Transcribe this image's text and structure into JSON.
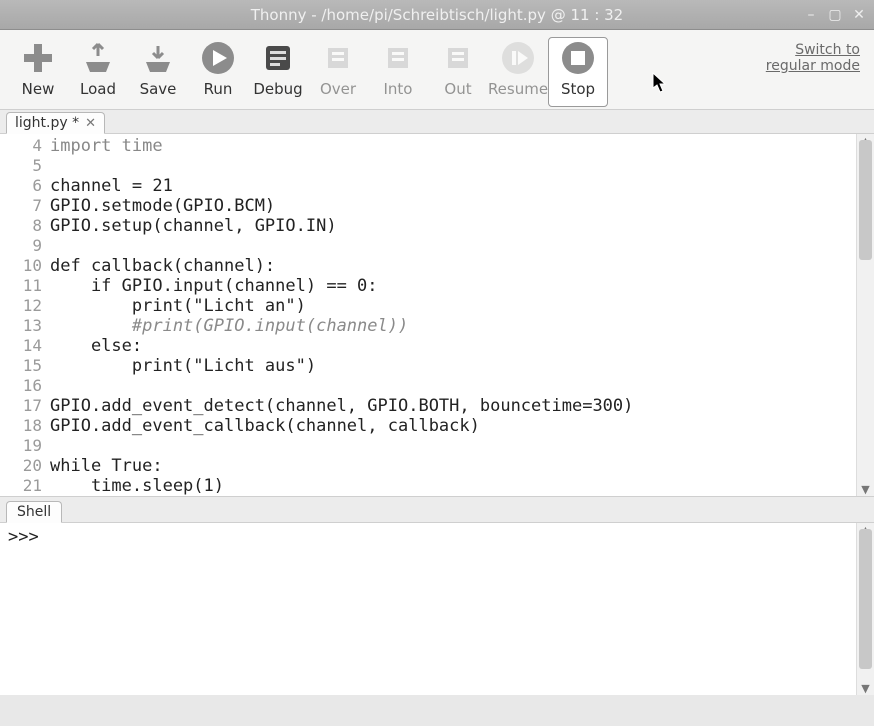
{
  "window": {
    "title": "Thonny  -  /home/pi/Schreibtisch/light.py  @  11 : 32"
  },
  "toolbar": {
    "new": "New",
    "load": "Load",
    "save": "Save",
    "run": "Run",
    "debug": "Debug",
    "over": "Over",
    "into": "Into",
    "out": "Out",
    "resume": "Resume",
    "stop": "Stop"
  },
  "links": {
    "switch_to": "Switch to",
    "regular_mode": "regular mode"
  },
  "tabs": {
    "editor": "light.py *"
  },
  "editor": {
    "line_numbers": [
      "4",
      "5",
      "6",
      "7",
      "8",
      "9",
      "10",
      "11",
      "12",
      "13",
      "14",
      "15",
      "16",
      "17",
      "18",
      "19",
      "20",
      "21"
    ],
    "lines": {
      "l4": "import time",
      "l5": "",
      "l6": "channel = 21",
      "l7": "GPIO.setmode(GPIO.BCM)",
      "l8": "GPIO.setup(channel, GPIO.IN)",
      "l9": "",
      "l10": "def callback(channel):",
      "l11": "    if GPIO.input(channel) == 0:",
      "l12": "        print(\"Licht an\")",
      "l13": "        #print(GPIO.input(channel))",
      "l14": "    else:",
      "l15": "        print(\"Licht aus\")",
      "l16": "",
      "l17": "GPIO.add_event_detect(channel, GPIO.BOTH, bouncetime=300)",
      "l18": "GPIO.add_event_callback(channel, callback)",
      "l19": "",
      "l20": "while True:",
      "l21": "    time.sleep(1)"
    }
  },
  "shell": {
    "tab": "Shell",
    "prompt": ">>>"
  }
}
